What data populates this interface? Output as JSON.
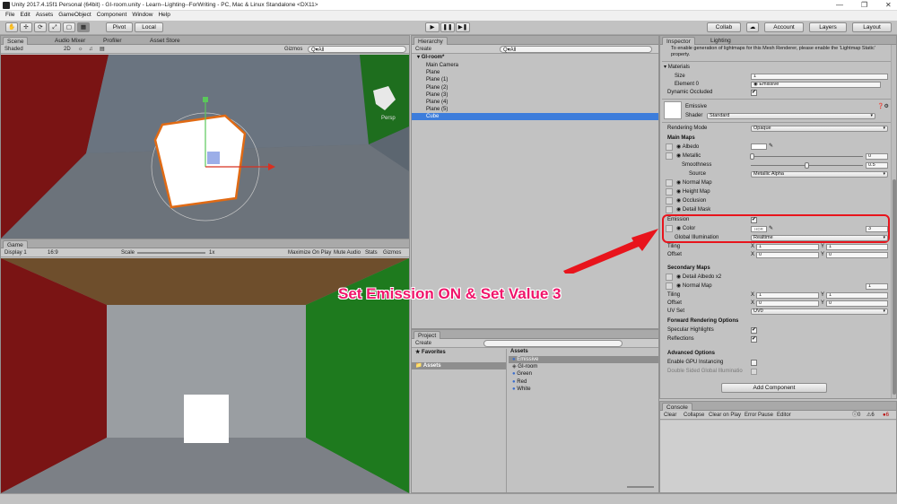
{
  "window": {
    "title": "Unity 2017.4.15f1 Personal (64bit) - GI-room.unity - Learn--Lighting--ForWriting - PC, Mac & Linux Standalone <DX11>",
    "controls": [
      "—",
      "❐",
      "✕"
    ]
  },
  "menu": [
    "File",
    "Edit",
    "Assets",
    "GameObject",
    "Component",
    "Window",
    "Help"
  ],
  "toolbar": {
    "pivot": "Pivot",
    "local": "Local",
    "collab": "Collab",
    "account": "Account",
    "layers": "Layers",
    "layout": "Layout",
    "cloud": "☁"
  },
  "scene": {
    "tabs": [
      "Scene",
      "Audio Mixer",
      "Profiler",
      "Asset Store"
    ],
    "shading": "Shaded",
    "mode_2d": "2D",
    "gizmos": "Gizmos",
    "search": "Q▾All",
    "persp": "Persp"
  },
  "game": {
    "tab": "Game",
    "display": "Display 1",
    "aspect": "16:9",
    "scale_label": "Scale",
    "scale_value": "1x",
    "options": [
      "Maximize On Play",
      "Mute Audio",
      "Stats",
      "Gizmos"
    ]
  },
  "hierarchy": {
    "tab": "Hierarchy",
    "create": "Create",
    "search": "Q▾All",
    "scene": "GI-room*",
    "items": [
      "Main Camera",
      "Plane",
      "Plane (1)",
      "Plane (2)",
      "Plane (3)",
      "Plane (4)",
      "Plane (5)",
      "Cube"
    ],
    "selected": "Cube"
  },
  "project": {
    "tab": "Project",
    "create": "Create",
    "favorites": "Favorites",
    "assets_folder": "Assets",
    "assets_header": "Assets",
    "items": [
      {
        "name": "Emissive",
        "icon": "material-icon"
      },
      {
        "name": "GI-room",
        "icon": "unity-scene-icon"
      },
      {
        "name": "Green",
        "icon": "material-icon"
      },
      {
        "name": "Red",
        "icon": "material-icon"
      },
      {
        "name": "White",
        "icon": "material-icon"
      }
    ],
    "selected": "Emissive"
  },
  "inspector": {
    "tabs": [
      "Inspector",
      "Lighting"
    ],
    "hint": "To enable generation of lightmaps for this Mesh Renderer, please enable the 'Lightmap Static' property.",
    "materials": {
      "label": "Materials",
      "size_label": "Size",
      "size": "1",
      "element0_label": "Element 0",
      "element0": "Emissive"
    },
    "dynamic_occluded": "Dynamic Occluded",
    "material_name": "Emissive",
    "shader_label": "Shader",
    "shader": "Standard",
    "rendering_mode_label": "Rendering Mode",
    "rendering_mode": "Opaque",
    "main_maps": "Main Maps",
    "albedo": "Albedo",
    "metallic": "Metallic",
    "metallic_value": "0",
    "smoothness": "Smoothness",
    "smoothness_value": "0.5",
    "source": "Source",
    "source_value": "Metallic Alpha",
    "normal_map": "Normal Map",
    "height_map": "Height Map",
    "occlusion": "Occlusion",
    "detail_mask": "Detail Mask",
    "emission": "Emission",
    "color": "Color",
    "hdr": "HDR",
    "emission_value": "3",
    "global_illumination": "Global Illumination",
    "gi_value": "Realtime",
    "tiling": "Tiling",
    "offset": "Offset",
    "tiling_x": "1",
    "tiling_y": "1",
    "offset_x": "0",
    "offset_y": "0",
    "x": "X",
    "y": "Y",
    "secondary_maps": "Secondary Maps",
    "detail_albedo": "Detail Albedo x2",
    "sec_normal_map": "Normal Map",
    "sec_normal_value": "1",
    "sec_tiling_x": "1",
    "sec_tiling_y": "1",
    "sec_offset_x": "0",
    "sec_offset_y": "0",
    "uv_set": "UV Set",
    "uv_value": "UV0",
    "forward_options": "Forward Rendering Options",
    "specular": "Specular Highlights",
    "reflections": "Reflections",
    "advanced": "Advanced Options",
    "gpu_instancing": "Enable GPU Instancing",
    "double_sided": "Double Sided Global Illuminatio",
    "add_component": "Add Component"
  },
  "console": {
    "tab": "Console",
    "buttons": [
      "Clear",
      "Collapse",
      "Clear on Play",
      "Error Pause",
      "Editor"
    ],
    "info": "0",
    "warn": "6",
    "error": "6"
  },
  "annotation": {
    "text": "Set Emission ON & Set Value 3",
    "color": "#f0146a",
    "arrow": "#e8141c"
  },
  "colors": {
    "selection": "#3d7ddb",
    "red_wall": "#7a1414",
    "green_wall": "#1e6e1e",
    "highlight": "#e8141c"
  }
}
